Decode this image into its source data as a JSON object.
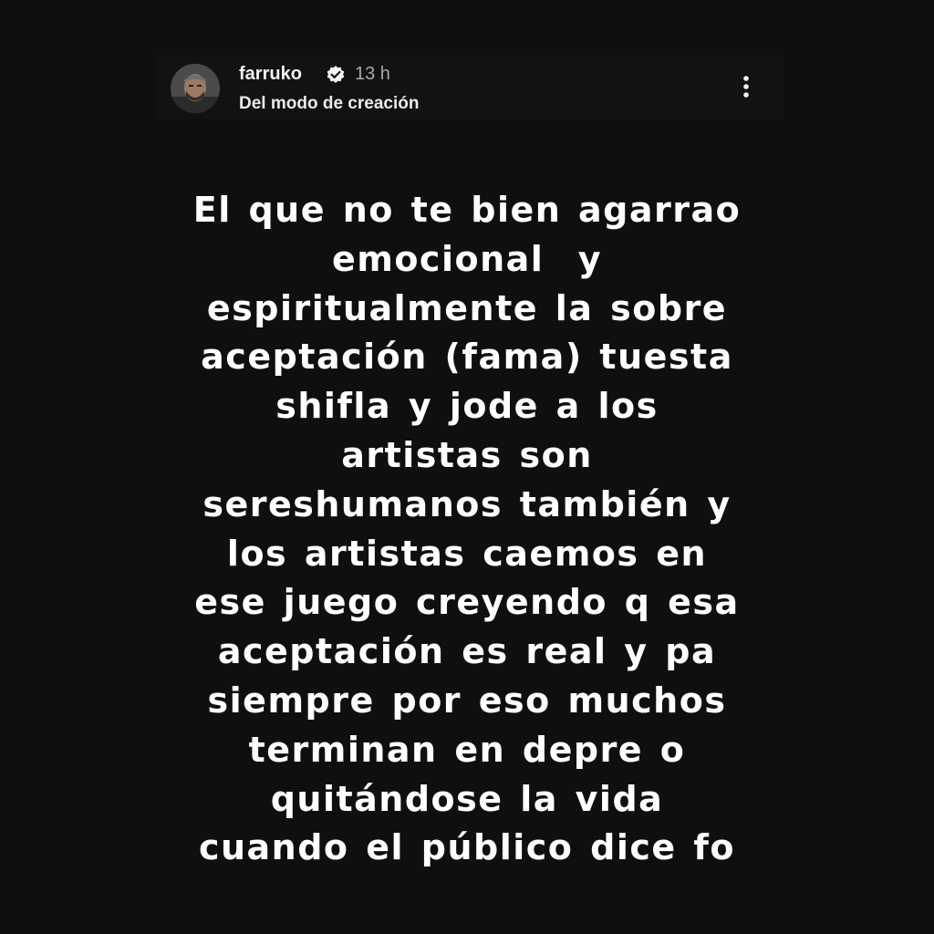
{
  "header": {
    "username": "farruko",
    "timestamp": "13 h",
    "subtitle": "Del modo de creación",
    "verified_icon": "verified-badge-icon",
    "menu_icon": "more-vertical-icon",
    "avatar": "user-avatar"
  },
  "story": {
    "lines": [
      "El que no te bien agarrao",
      "emocional  y",
      "espiritualmente la sobre",
      "aceptación (fama) tuesta",
      "shifla y jode a los",
      "artistas son",
      "sereshumanos también y",
      "los artistas caemos en",
      "ese juego creyendo q esa",
      "aceptación es real y pa",
      "siempre por eso muchos",
      "terminan en depre o",
      "quitándose la vida",
      "cuando el público dice fo"
    ],
    "colors": {
      "background": "#0f0f0f",
      "header_background": "#121212",
      "text": "#ffffff",
      "muted": "#a8a8a8"
    }
  }
}
